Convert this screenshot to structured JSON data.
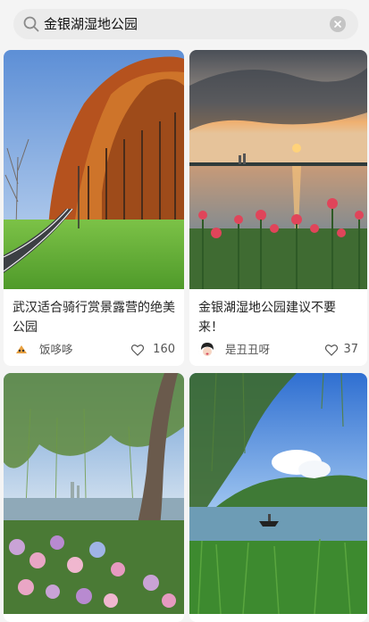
{
  "search": {
    "query": "金银湖湿地公园"
  },
  "cards": [
    {
      "title": "武汉适合骑行赏景露营的绝美公园",
      "author": "饭哆哆",
      "likes": "160"
    },
    {
      "title": "金银湖湿地公园建议不要来！",
      "author": "是丑丑呀",
      "likes": "37"
    },
    {
      "title": "",
      "author": "",
      "likes": ""
    },
    {
      "title": "",
      "author": "",
      "likes": ""
    }
  ],
  "colors": {
    "background": "#f4f4f4",
    "search_bg": "#ebebeb",
    "card": "#ffffff"
  },
  "icons": [
    "search-icon",
    "clear-icon",
    "heart-icon"
  ]
}
